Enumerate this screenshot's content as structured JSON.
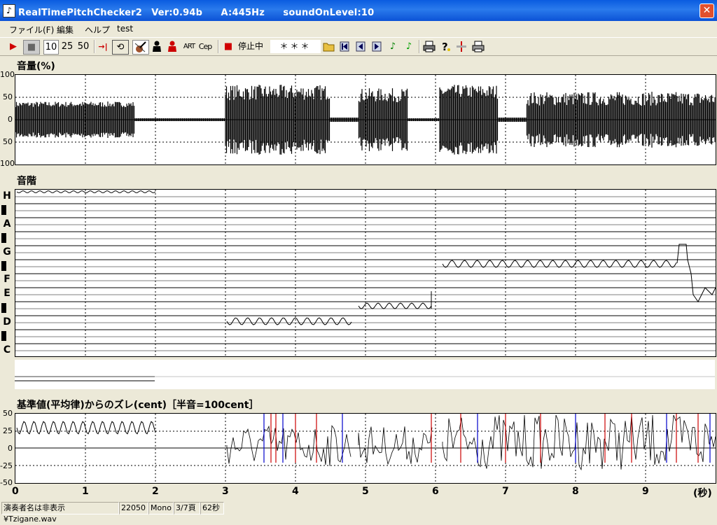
{
  "window": {
    "title": "RealTimePitchChecker2　Ver:0.94b　　A:445Hz　　soundOnLevel:10",
    "close_glyph": "✕"
  },
  "menu": [
    "ファイル(F)",
    "編集",
    "ヘルプ",
    "test"
  ],
  "toolbar": {
    "play": "▶",
    "stop": "■",
    "zoom": [
      "10",
      "25",
      "50"
    ],
    "go_end": "→|",
    "loop": "⟲",
    "art": "ART",
    "cep": "Cep",
    "status_text": "停止中",
    "value_text": "＊＊＊",
    "note_glyph": "♪"
  },
  "volume": {
    "label": "音量(%)",
    "y_ticks": [
      "100",
      "50",
      "0",
      "50",
      "100"
    ]
  },
  "scale": {
    "label": "音階",
    "notes": [
      "H",
      "A",
      "G",
      "F",
      "E",
      "D",
      "C"
    ]
  },
  "cent": {
    "label": "基準値(平均律)からのズレ(cent)［半音=100cent］",
    "y_ticks": [
      "50",
      "25",
      "0",
      "-25",
      "-50"
    ]
  },
  "x_axis": {
    "ticks": [
      "0",
      "1",
      "2",
      "3",
      "4",
      "5",
      "6",
      "7",
      "8",
      "9"
    ],
    "unit": "(秒)"
  },
  "statusbar": [
    "演奏者名は非表示¥Tzigane.wav",
    "22050",
    "Mono",
    "3/7頁",
    "62秒"
  ],
  "colors": {
    "title_bar": "#0a5ce0",
    "deviation_red": "#cc0000",
    "deviation_blue": "#0000cc"
  }
}
